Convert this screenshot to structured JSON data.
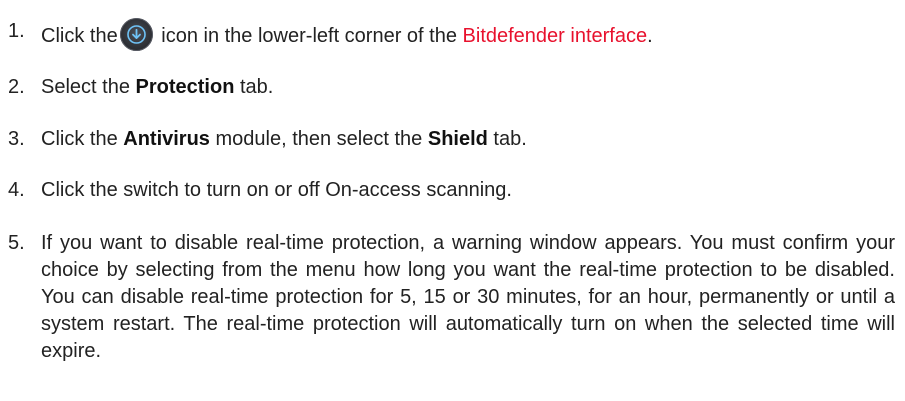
{
  "steps": [
    {
      "number": "1.",
      "before_icon": "Click the",
      "icon": "download-arrow-icon",
      "after_icon": " icon in the lower-left corner of the ",
      "link": "Bitdefender interface",
      "end": "."
    },
    {
      "number": "2.",
      "before": "Select the ",
      "bold": "Protection",
      "after": " tab."
    },
    {
      "number": "3.",
      "before": "Click the ",
      "bold1": "Antivirus",
      "middle": " module, then select the ",
      "bold2": "Shield",
      "after": " tab."
    },
    {
      "number": "4.",
      "text": "Click the switch to turn on or off On-access scanning."
    },
    {
      "number": "5.",
      "text": "If you want to disable real-time protection, a warning window appears. You must confirm your choice by selecting from the menu how long you want the real-time protection to be disabled. You can disable real-time protection for 5, 15 or 30 minutes, for an hour, permanently or until a system restart. The real-time protection will automatically turn on when the selected time will expire."
    }
  ],
  "colors": {
    "link": "#e8112d",
    "text": "#222222",
    "icon_bg": "#2a2c31",
    "icon_arrow": "#6fc3f7"
  }
}
